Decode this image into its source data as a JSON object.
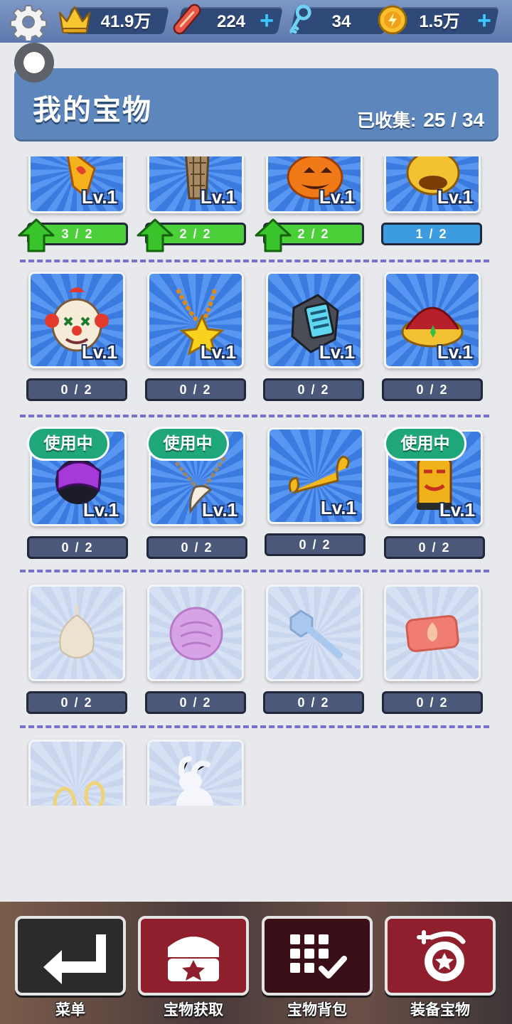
{
  "topbar": {
    "crowns": "41.9万",
    "boards": "224",
    "keys": "34",
    "coins": "1.5万",
    "plus": "+"
  },
  "header": {
    "title": "我的宝物",
    "collected_label": "已收集:",
    "collected_value": "25 / 34"
  },
  "level_label": "Lv.1",
  "in_use_label": "使用中",
  "rows": [
    {
      "items": [
        {
          "icon": "fire-scroll-icon",
          "progress": "3 / 2",
          "state": "upgrade"
        },
        {
          "icon": "tower-icon",
          "progress": "2 / 2",
          "state": "upgrade"
        },
        {
          "icon": "pumpkin-icon",
          "progress": "2 / 2",
          "state": "upgrade"
        },
        {
          "icon": "golden-mask-icon",
          "progress": "1 / 2",
          "state": "partial"
        }
      ]
    },
    {
      "items": [
        {
          "icon": "clown-mask-icon",
          "progress": "0 / 2"
        },
        {
          "icon": "star-necklace-icon",
          "progress": "0 / 2"
        },
        {
          "icon": "smartwatch-icon",
          "progress": "0 / 2"
        },
        {
          "icon": "crown-icon",
          "progress": "0 / 2"
        }
      ]
    },
    {
      "items": [
        {
          "icon": "helmet-icon",
          "progress": "0 / 2",
          "in_use": true
        },
        {
          "icon": "tooth-necklace-icon",
          "progress": "0 / 2",
          "in_use": true
        },
        {
          "icon": "magic-carpet-icon",
          "progress": "0 / 2"
        },
        {
          "icon": "tiki-mask-icon",
          "progress": "0 / 2",
          "in_use": true
        }
      ]
    },
    {
      "items": [
        {
          "icon": "onion-icon",
          "progress": "0 / 2",
          "locked": true
        },
        {
          "icon": "brain-flower-icon",
          "progress": "0 / 2",
          "locked": true
        },
        {
          "icon": "wrench-icon",
          "progress": "0 / 2",
          "locked": true
        },
        {
          "icon": "fire-badge-icon",
          "progress": "0 / 2",
          "locked": true
        }
      ]
    },
    {
      "items": [
        {
          "icon": "gold-rings-icon",
          "locked": true
        },
        {
          "icon": "white-rabbit-icon",
          "locked": true
        }
      ]
    }
  ],
  "bottom_nav": [
    {
      "label": "菜单",
      "icon": "return-arrow-icon",
      "color": "#2b2b2b"
    },
    {
      "label": "宝物获取",
      "icon": "treasure-chest-icon",
      "color": "#8f1f2c"
    },
    {
      "label": "宝物背包",
      "icon": "inventory-grid-icon",
      "color": "#3a0f18"
    },
    {
      "label": "装备宝物",
      "icon": "equip-treasure-icon",
      "color": "#8f1f2c"
    }
  ],
  "colors": {
    "header_bg": "#5d87bc",
    "card_blue": "#3b7be0",
    "progress_green": "#4bd03a",
    "progress_grey": "#4b587a",
    "in_use_green": "#1fa67a",
    "divider": "#7a6fca"
  }
}
